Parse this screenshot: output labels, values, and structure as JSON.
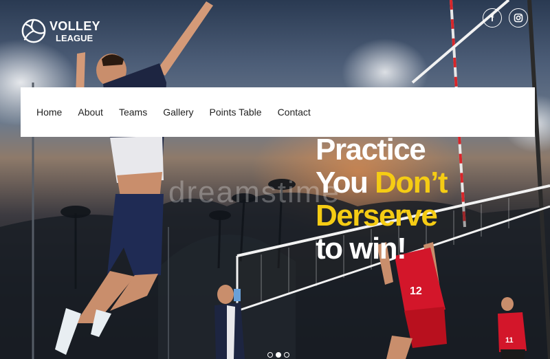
{
  "brand": {
    "line1": "VOLLEY",
    "line2": "LEAGUE"
  },
  "social": [
    {
      "icon": "facebook-icon",
      "glyph": "f"
    },
    {
      "icon": "instagram-icon",
      "glyph": "◎"
    }
  ],
  "nav": {
    "items": [
      "Home",
      "About",
      "Teams",
      "Gallery",
      "Points Table",
      "Contact"
    ]
  },
  "hero": {
    "headline": {
      "line1": "Practice",
      "line2_white": "You",
      "line2_yellow": "Don’t",
      "line3": "Derserve",
      "line4": "to win!"
    },
    "watermark": "dreamstime"
  },
  "slider": {
    "slides": 3,
    "active_index": 1
  },
  "colors": {
    "accent": "#f5cc14",
    "nav_bg": "#ffffff",
    "nav_text": "#222222"
  }
}
